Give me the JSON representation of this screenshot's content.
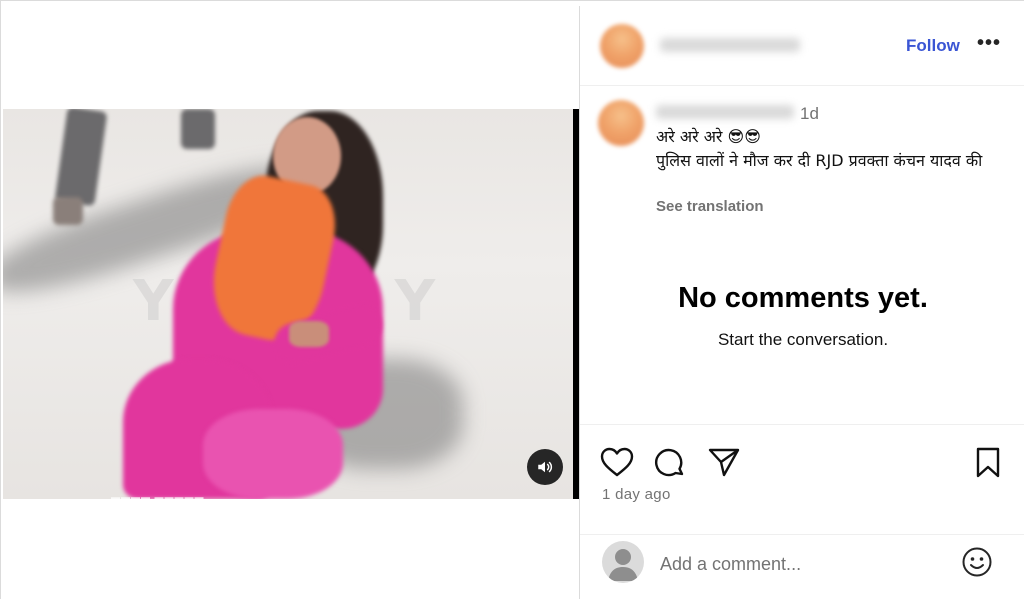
{
  "post": {
    "time_short": "1d",
    "caption_line1": "अरे अरे अरे 😎😎",
    "caption_line2": "पुलिस वालों ने मौज कर दी RJD प्रवक्ता कंचन यादव की",
    "see_translation": "See translation",
    "time_ago": "1 day ago"
  },
  "header": {
    "follow_label": "Follow",
    "more_label": "•••"
  },
  "comments": {
    "empty_title": "No comments yet.",
    "empty_subtitle": "Start the conversation."
  },
  "composer": {
    "placeholder": "Add a comment..."
  },
  "icons": {
    "like": "heart-icon",
    "comment": "comment-bubble-icon",
    "share": "paper-plane-icon",
    "save": "bookmark-icon",
    "emoji": "smiley-icon",
    "audio": "speaker-icon"
  },
  "colors": {
    "follow": "#3a55d4",
    "muted": "#737373",
    "divider": "#efefef"
  }
}
